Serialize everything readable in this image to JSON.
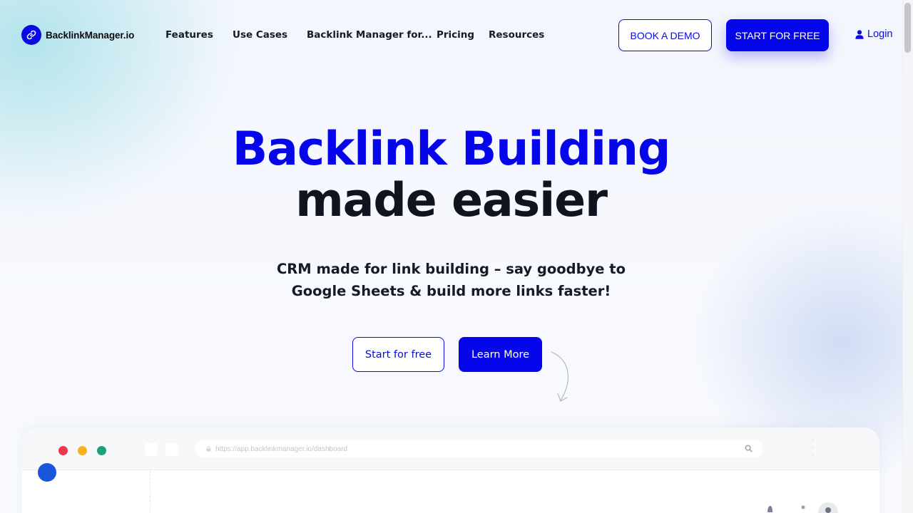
{
  "brand": {
    "name": "BacklinkManager.io",
    "color": "#0a0ae6",
    "icon": "link-icon"
  },
  "nav": {
    "items": [
      {
        "label": "Features"
      },
      {
        "label": "Use Cases"
      },
      {
        "label": "Backlink Manager for..."
      },
      {
        "label": "Pricing"
      },
      {
        "label": "Resources"
      }
    ],
    "book_demo": "BOOK A DEMO",
    "start_free": "START FOR FREE",
    "login": "Login",
    "login_icon": "user-icon"
  },
  "hero": {
    "title_line1": "Backlink Building",
    "title_line2": "made easier",
    "subtitle": "CRM made for link building – say goodbye to Google Sheets & build more links faster!",
    "cta_secondary": "Start for free",
    "cta_primary": "Learn More"
  },
  "preview": {
    "url": "https://app.backlinkmanager.io/dashboard",
    "window_dots": [
      "#f0364f",
      "#f7b11c",
      "#1ea07a"
    ]
  }
}
